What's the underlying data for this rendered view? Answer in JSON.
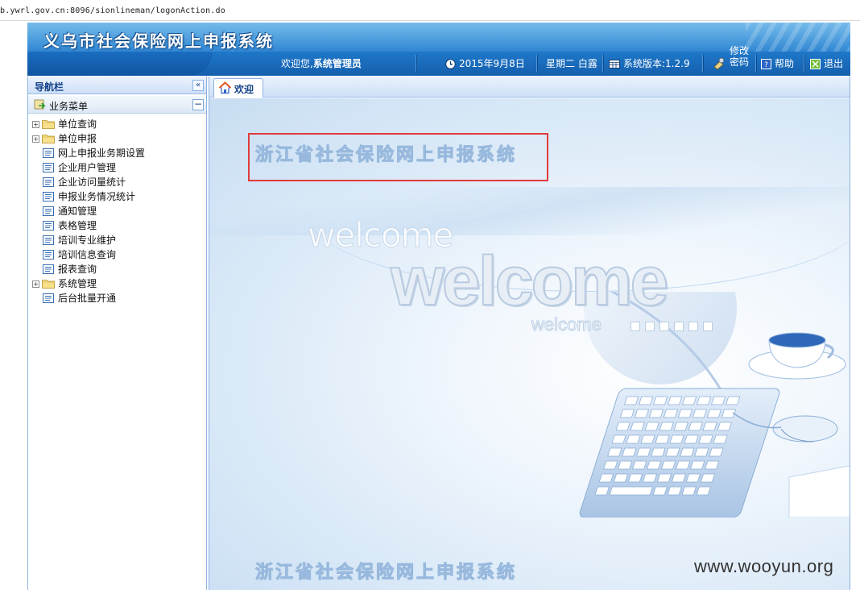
{
  "browser": {
    "url": "b.ywrl.gov.cn:8096/sionlineman/logonAction.do"
  },
  "banner": {
    "title": "义乌市社会保险网上申报系统",
    "welcome_text": "欢迎您,",
    "user": "系统管理员",
    "date": "2015年9月8日",
    "weekday_term": "星期二 白露",
    "version": "系统版本:1.2.9",
    "change_password_line1": "修改",
    "change_password_line2": "密码",
    "help": "帮助",
    "logout": "退出"
  },
  "nav": {
    "title": "导航栏",
    "menu_title": "业务菜单",
    "items": [
      {
        "label": "单位查询",
        "type": "folder"
      },
      {
        "label": "单位申报",
        "type": "folder"
      },
      {
        "label": "网上申报业务期设置",
        "type": "leaf"
      },
      {
        "label": "企业用户管理",
        "type": "leaf"
      },
      {
        "label": "企业访问量统计",
        "type": "leaf"
      },
      {
        "label": "申报业务情况统计",
        "type": "leaf"
      },
      {
        "label": "通知管理",
        "type": "leaf"
      },
      {
        "label": "表格管理",
        "type": "leaf"
      },
      {
        "label": "培训专业维护",
        "type": "leaf"
      },
      {
        "label": "培训信息查询",
        "type": "leaf"
      },
      {
        "label": "报表查询",
        "type": "leaf"
      },
      {
        "label": "系统管理",
        "type": "folder"
      },
      {
        "label": "后台批量开通",
        "type": "leaf"
      }
    ]
  },
  "content": {
    "tab_label": "欢迎",
    "banner_text_top": "浙江省社会保险网上申报系统",
    "welcome_small": "welcome",
    "welcome_big": "welcome",
    "welcome_tiny": "welcome",
    "banner_text_bottom": "浙江省社会保险网上申报系统"
  },
  "watermark": "www.wooyun.org",
  "colors": {
    "banner_blue": "#2b86d3",
    "nav_title": "#15428b",
    "highlight_red": "#e13b3b"
  }
}
